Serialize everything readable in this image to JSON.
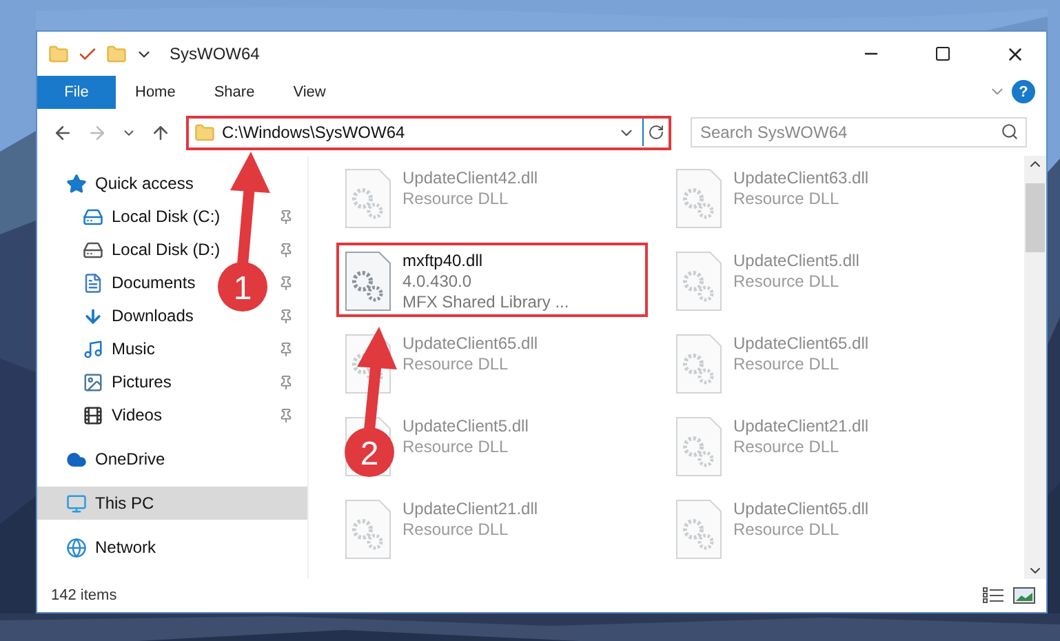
{
  "window": {
    "title": "SysWOW64"
  },
  "ribbon_tabs": [
    {
      "label": "File",
      "kind": "file"
    },
    {
      "label": "Home",
      "kind": "tab"
    },
    {
      "label": "Share",
      "kind": "tab"
    },
    {
      "label": "View",
      "kind": "tab"
    }
  ],
  "help": {
    "label": "?"
  },
  "address": {
    "path": "C:\\Windows\\SysWOW64",
    "highlighted": true
  },
  "search": {
    "placeholder": "Search SysWOW64"
  },
  "sidebar": {
    "items": [
      {
        "label": "Quick access",
        "kind": "quickaccess",
        "selected": false,
        "children": [
          {
            "label": "Local Disk (C:)",
            "kind": "systemdrive",
            "pinned": true,
            "selected": false
          },
          {
            "label": "Local Disk (D:)",
            "kind": "drive",
            "pinned": true,
            "selected": false
          },
          {
            "label": "Documents",
            "kind": "documents",
            "pinned": true,
            "selected": false
          },
          {
            "label": "Downloads",
            "kind": "downloads",
            "pinned": true,
            "selected": false
          },
          {
            "label": "Music",
            "kind": "music",
            "pinned": true,
            "selected": false
          },
          {
            "label": "Pictures",
            "kind": "pictures",
            "pinned": true,
            "selected": false
          },
          {
            "label": "Videos",
            "kind": "videos",
            "pinned": true,
            "selected": false
          }
        ]
      },
      {
        "label": "OneDrive",
        "kind": "onedrive",
        "selected": false
      },
      {
        "label": "This PC",
        "kind": "pc",
        "selected": true
      },
      {
        "label": "Network",
        "kind": "network",
        "selected": false
      }
    ]
  },
  "files": [
    {
      "name": "UpdateClient42.dll",
      "lines": [
        "Resource DLL"
      ],
      "blurred": true,
      "highlighted": false
    },
    {
      "name": "UpdateClient63.dll",
      "lines": [
        "Resource DLL"
      ],
      "blurred": true,
      "highlighted": false
    },
    {
      "name": "mxftp40.dll",
      "lines": [
        "4.0.430.0",
        "MFX Shared Library ..."
      ],
      "blurred": false,
      "highlighted": true
    },
    {
      "name": "UpdateClient5.dll",
      "lines": [
        "Resource DLL"
      ],
      "blurred": true,
      "highlighted": false
    },
    {
      "name": "UpdateClient65.dll",
      "lines": [
        "Resource DLL"
      ],
      "blurred": true,
      "highlighted": false
    },
    {
      "name": "UpdateClient65.dll",
      "lines": [
        "Resource DLL"
      ],
      "blurred": true,
      "highlighted": false
    },
    {
      "name": "UpdateClient5.dll",
      "lines": [
        "Resource DLL"
      ],
      "blurred": true,
      "highlighted": false
    },
    {
      "name": "UpdateClient21.dll",
      "lines": [
        "Resource DLL"
      ],
      "blurred": true,
      "highlighted": false
    },
    {
      "name": "UpdateClient21.dll",
      "lines": [
        "Resource DLL"
      ],
      "blurred": true,
      "highlighted": false
    },
    {
      "name": "UpdateClient65.dll",
      "lines": [
        "Resource DLL"
      ],
      "blurred": true,
      "highlighted": false
    }
  ],
  "status_bar": {
    "count": "142 items"
  },
  "callouts": [
    {
      "label": "1"
    },
    {
      "label": "2"
    }
  ]
}
